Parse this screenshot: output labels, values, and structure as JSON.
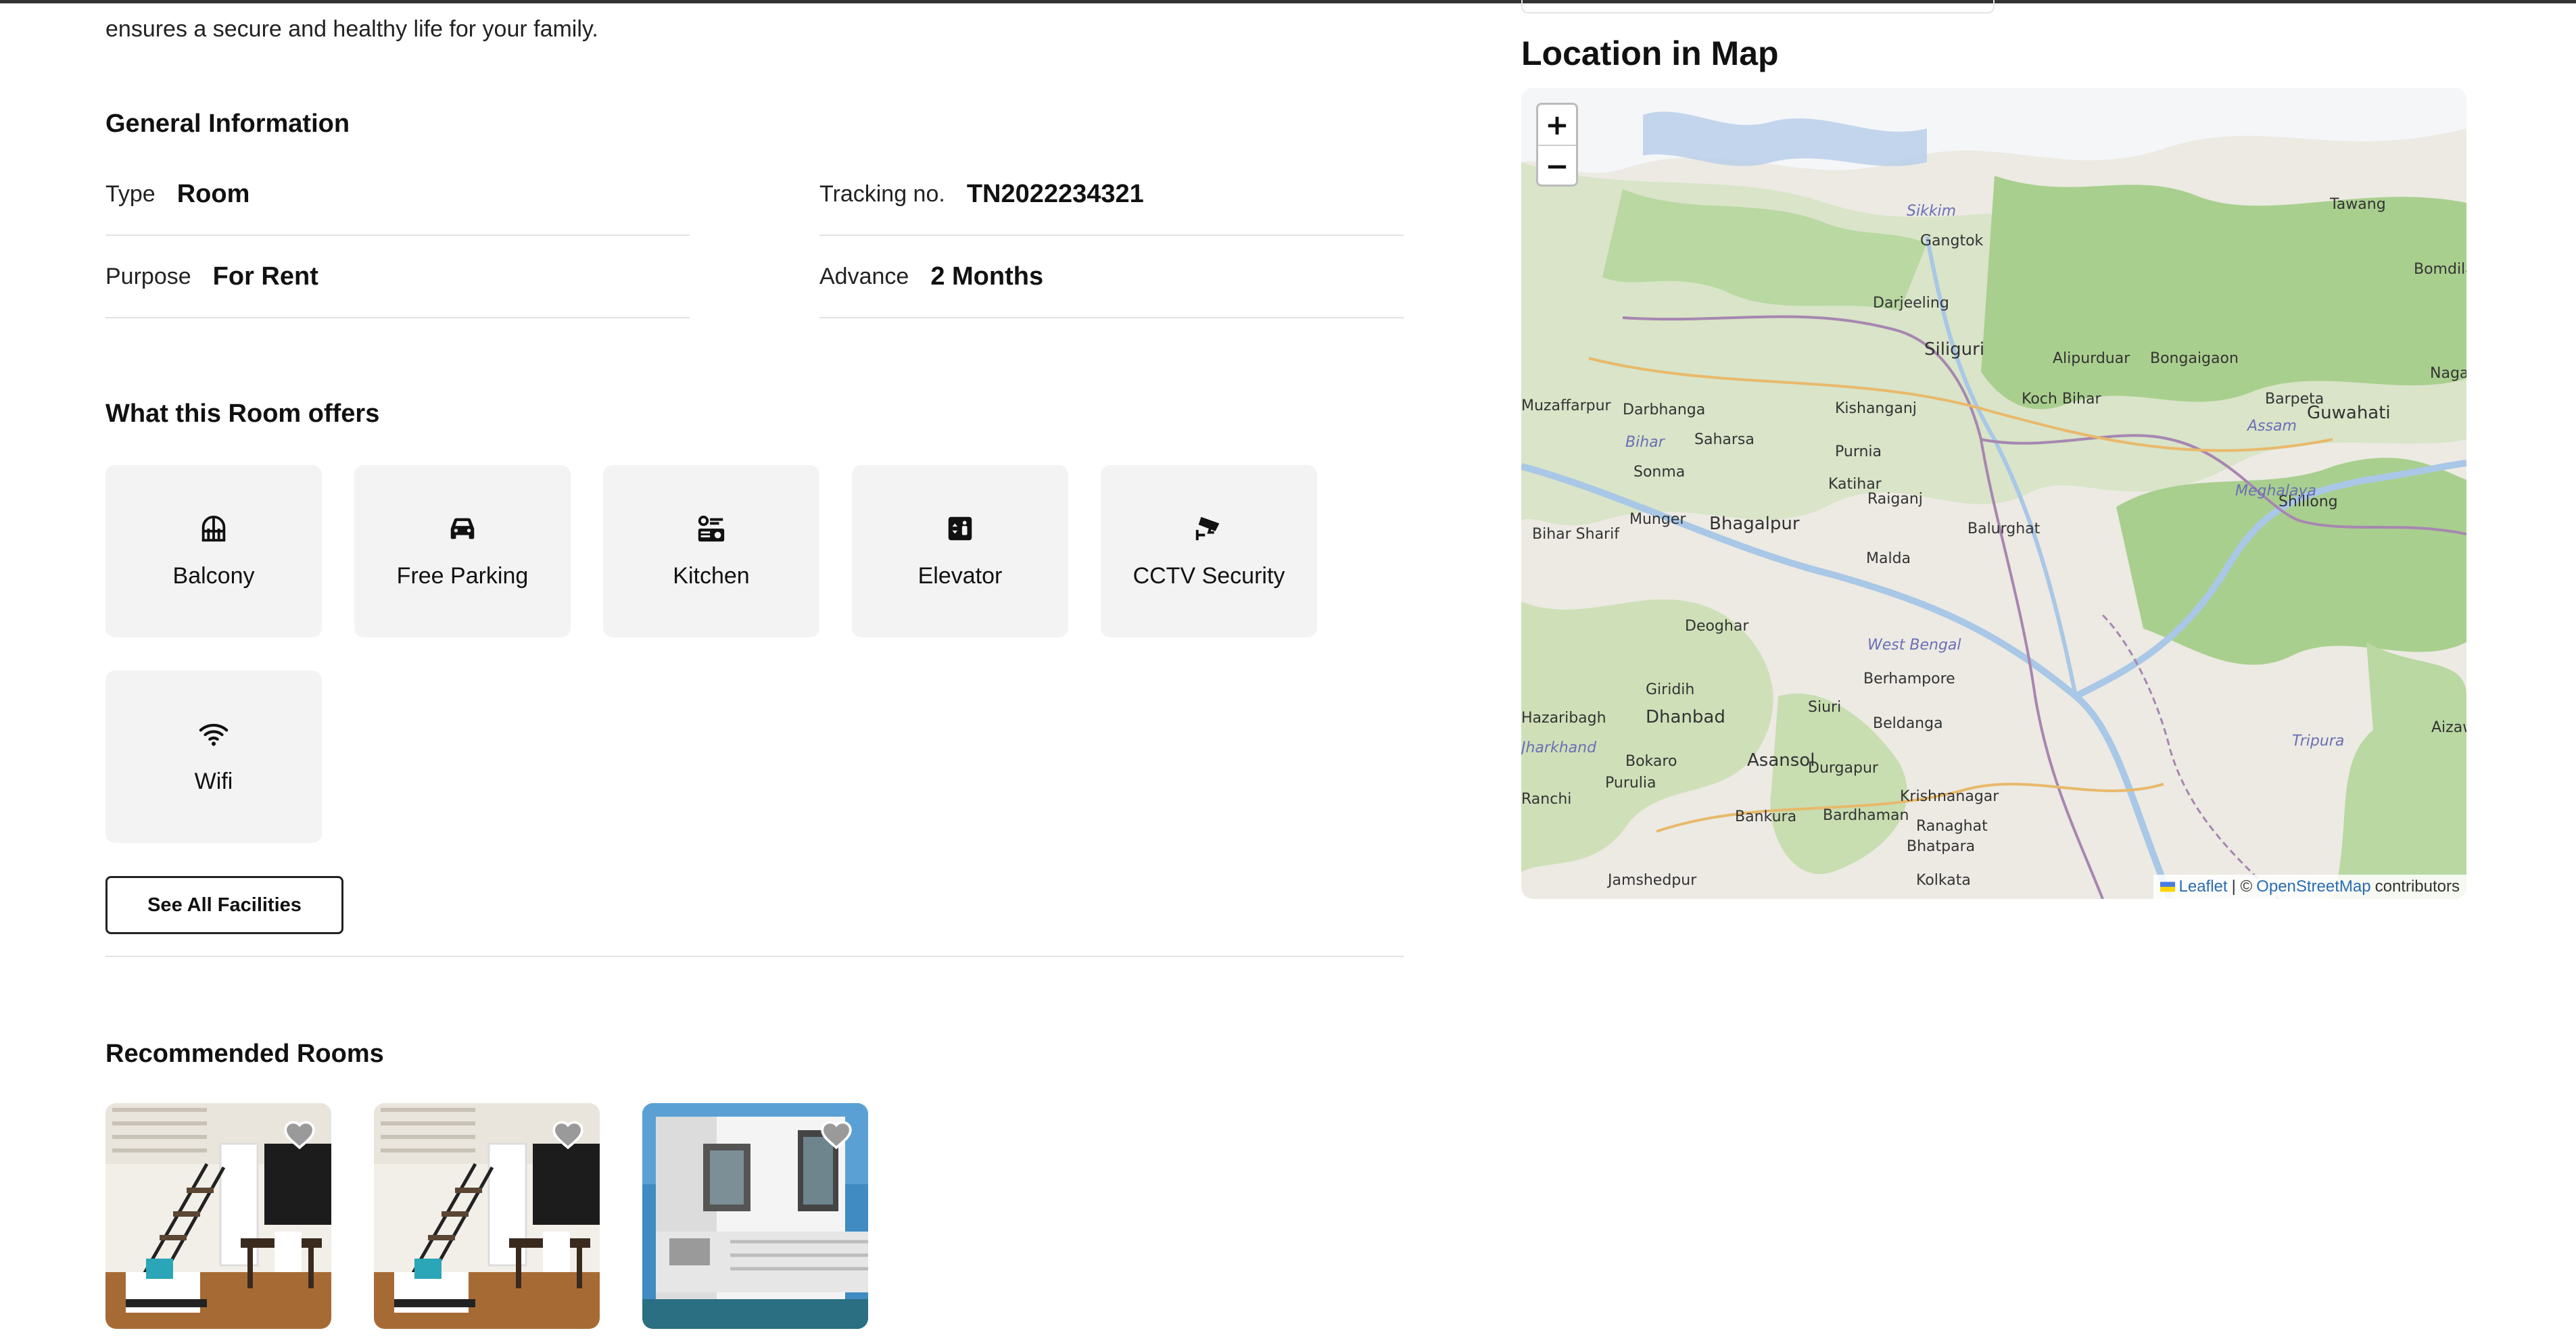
{
  "intro": {
    "text": "ensures a secure and healthy life for your family."
  },
  "general": {
    "title": "General Information",
    "type_label": "Type",
    "type_value": "Room",
    "tracking_label": "Tracking no.",
    "tracking_value": "TN2022234321",
    "purpose_label": "Purpose",
    "purpose_value": "For Rent",
    "advance_label": "Advance",
    "advance_value": "2 Months"
  },
  "offers": {
    "title": "What this Room offers",
    "items": [
      {
        "label": "Balcony",
        "icon": "balcony-icon"
      },
      {
        "label": "Free Parking",
        "icon": "car-icon"
      },
      {
        "label": "Kitchen",
        "icon": "kitchen-icon"
      },
      {
        "label": "Elevator",
        "icon": "elevator-icon"
      },
      {
        "label": "CCTV Security",
        "icon": "cctv-icon"
      },
      {
        "label": "Wifi",
        "icon": "wifi-icon"
      }
    ],
    "see_all_label": "See All Facilities"
  },
  "recommended": {
    "title": "Recommended Rooms",
    "rooms": [
      {
        "image": "interior-staircase-photo"
      },
      {
        "image": "interior-staircase-photo"
      },
      {
        "image": "white-building-exterior-photo"
      }
    ]
  },
  "map": {
    "title": "Location in Map",
    "zoom_in": "+",
    "zoom_out": "−",
    "labels": [
      "Sikkim",
      "Gangtok",
      "Darjeeling",
      "Siliguri",
      "Alipurduar",
      "Bongaigaon",
      "Tawang",
      "Bomdila",
      "Muzaffarpur",
      "Darbhanga",
      "Bihar",
      "Saharsa",
      "Purnia",
      "Kishanganj",
      "Koch Bihar",
      "Barpeta",
      "Assam",
      "Guwahati",
      "Nagaon",
      "Sonma",
      "Katihar",
      "Raiganj",
      "Balurghat",
      "Meghalaya",
      "Shillong",
      "Bihar Sharif",
      "Munger",
      "Bhagalpur",
      "Malda",
      "Deoghar",
      "West Bengal",
      "Berhampore",
      "Giridih",
      "Dhanbad",
      "Siuri",
      "Beldanga",
      "Tripura",
      "Hazaribagh",
      "Jharkhand",
      "Bokaro",
      "Asansol",
      "Durgapur",
      "Krishnanagar",
      "Purulia",
      "Ranchi",
      "Bankura",
      "Bardhaman",
      "Ranaghat",
      "Bhatpara",
      "Jamshedpur",
      "Kolkata",
      "Aizawl"
    ],
    "attribution": {
      "leaflet": "Leaflet",
      "sep": "| ©",
      "osm": "OpenStreetMap",
      "contributors": "contributors"
    }
  },
  "colors": {
    "card_bg": "#f3f3f3",
    "link": "#2a6db0",
    "map_green": "#b9d8a2",
    "map_base": "#eceae3",
    "river": "#a9c7e6",
    "border_purple": "#a786b0"
  }
}
